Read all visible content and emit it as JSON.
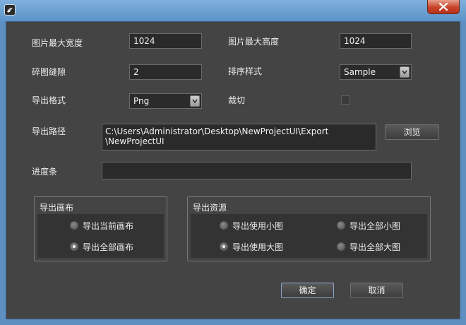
{
  "window": {
    "close_label": "×"
  },
  "settings": {
    "max_width_label": "图片最大宽度",
    "max_width_value": "1024",
    "max_height_label": "图片最大高度",
    "max_height_value": "1024",
    "gap_label": "碎图缝隙",
    "gap_value": "2",
    "sort_label": "排序样式",
    "sort_value": "Sample",
    "format_label": "导出格式",
    "format_value": "Png",
    "crop_label": "裁切",
    "crop_checked": false,
    "path_label": "导出路径",
    "path_line1": "C:\\Users\\Administrator\\Desktop\\NewProjectUI\\Export",
    "path_line2": "\\NewProjectUI",
    "browse_label": "浏览",
    "progress_label": "进度条",
    "progress_value": 0
  },
  "canvas_group": {
    "title": "导出画布",
    "options": [
      {
        "label": "导出当前画布",
        "selected": false
      },
      {
        "label": "导出全部画布",
        "selected": true
      }
    ]
  },
  "resource_group": {
    "title": "导出资源",
    "options": [
      {
        "label": "导出使用小图",
        "selected": false
      },
      {
        "label": "导出全部小图",
        "selected": false
      },
      {
        "label": "导出使用大图",
        "selected": true
      },
      {
        "label": "导出全部大图",
        "selected": false
      }
    ]
  },
  "actions": {
    "ok_label": "确定",
    "cancel_label": "取消"
  },
  "colors": {
    "panel": "#444444",
    "field": "#2a2a2a",
    "title_bar": "#5d8fc0",
    "close": "#c8432b"
  }
}
